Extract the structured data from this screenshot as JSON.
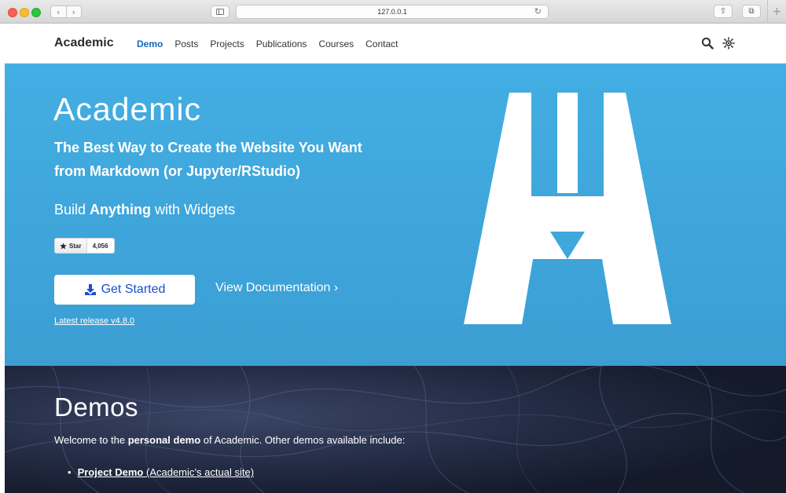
{
  "browser": {
    "url": "127.0.0.1",
    "back_glyph": "‹",
    "forward_glyph": "›",
    "reload_glyph": "↻",
    "new_tab_glyph": "+",
    "share_glyph": "⇧",
    "tabs_glyph": "⧉",
    "icons": [
      "sidebar-icon",
      "reload-icon",
      "share-icon",
      "tabs-overview-icon"
    ]
  },
  "nav": {
    "brand": "Academic",
    "items": [
      "Demo",
      "Posts",
      "Projects",
      "Publications",
      "Courses",
      "Contact"
    ],
    "active": "Demo",
    "icons": [
      "search-icon",
      "theme-toggle-icon"
    ]
  },
  "hero": {
    "title": "Academic",
    "subtitle": "The Best Way to Create the Website You Want from Markdown (or Jupyter/RStudio)",
    "widgets_prefix": "Build ",
    "widgets_bold": "Anything",
    "widgets_suffix": " with Widgets",
    "star_label": "Star",
    "star_count": "4,056",
    "cta_label": "Get Started",
    "docs_label": "View Documentation ›",
    "release_link": "Latest release v4.8.0",
    "background_color": "#43aee3",
    "cta_text_color": "#1a4dd6"
  },
  "demos": {
    "title": "Demos",
    "intro_prefix": "Welcome to the ",
    "intro_bold": "personal demo",
    "intro_suffix": " of Academic. Other demos available include:",
    "list": [
      {
        "name": "Project Demo",
        "note": " (Academic’s actual site)"
      }
    ]
  }
}
